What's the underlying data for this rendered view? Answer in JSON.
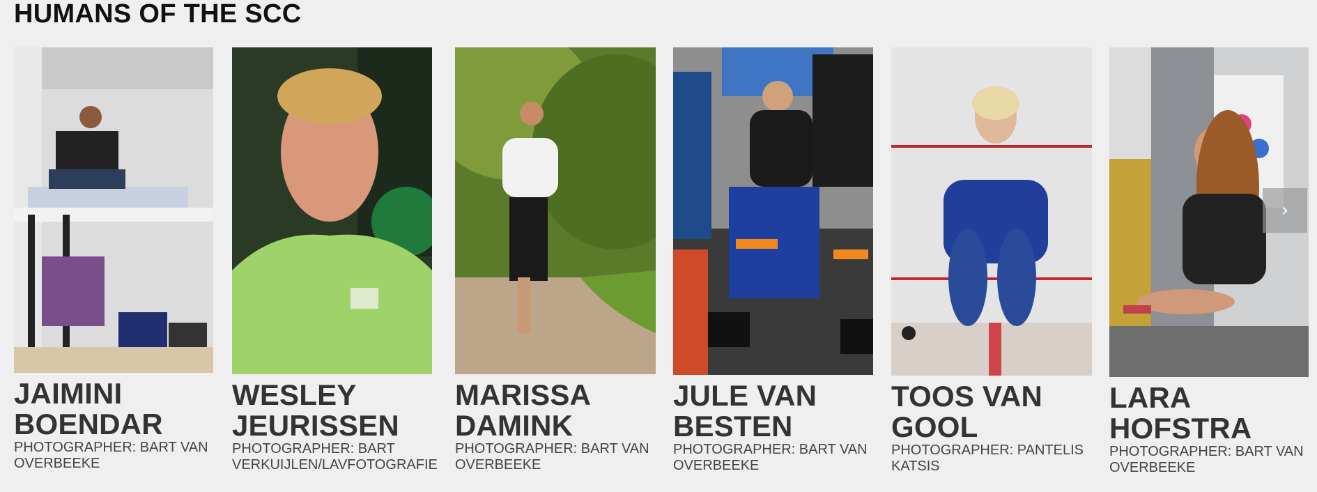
{
  "section": {
    "title": "HUMANS OF THE SCC"
  },
  "cards": [
    {
      "name_line1": "JAIMINI",
      "name_line2": "BOENDAR",
      "credit_line1": "PHOTOGRAPHER: BART VAN",
      "credit_line2": "OVERBEEKE"
    },
    {
      "name_line1": "WESLEY",
      "name_line2": "JEURISSEN",
      "credit_line1": "PHOTOGRAPHER: BART",
      "credit_line2": "VERKUIJLEN/LAVFOTOGRAFIE"
    },
    {
      "name_line1": "MARISSA",
      "name_line2": "DAMINK",
      "credit_line1": "PHOTOGRAPHER: BART VAN",
      "credit_line2": "OVERBEEKE"
    },
    {
      "name_line1": "JULE VAN",
      "name_line2": "BESTEN",
      "credit_line1": "PHOTOGRAPHER: BART VAN",
      "credit_line2": "OVERBEEKE"
    },
    {
      "name_line1": "TOOS VAN",
      "name_line2": "GOOL",
      "credit_line1": "PHOTOGRAPHER: PANTELIS",
      "credit_line2": "KATSIS"
    },
    {
      "name_line1": "LARA",
      "name_line2": "HOFSTRA",
      "credit_line1": "PHOTOGRAPHER: BART VAN",
      "credit_line2": "OVERBEEKE"
    }
  ],
  "carousel": {
    "next_icon": "chevron-right-icon",
    "next_glyph": "›"
  }
}
